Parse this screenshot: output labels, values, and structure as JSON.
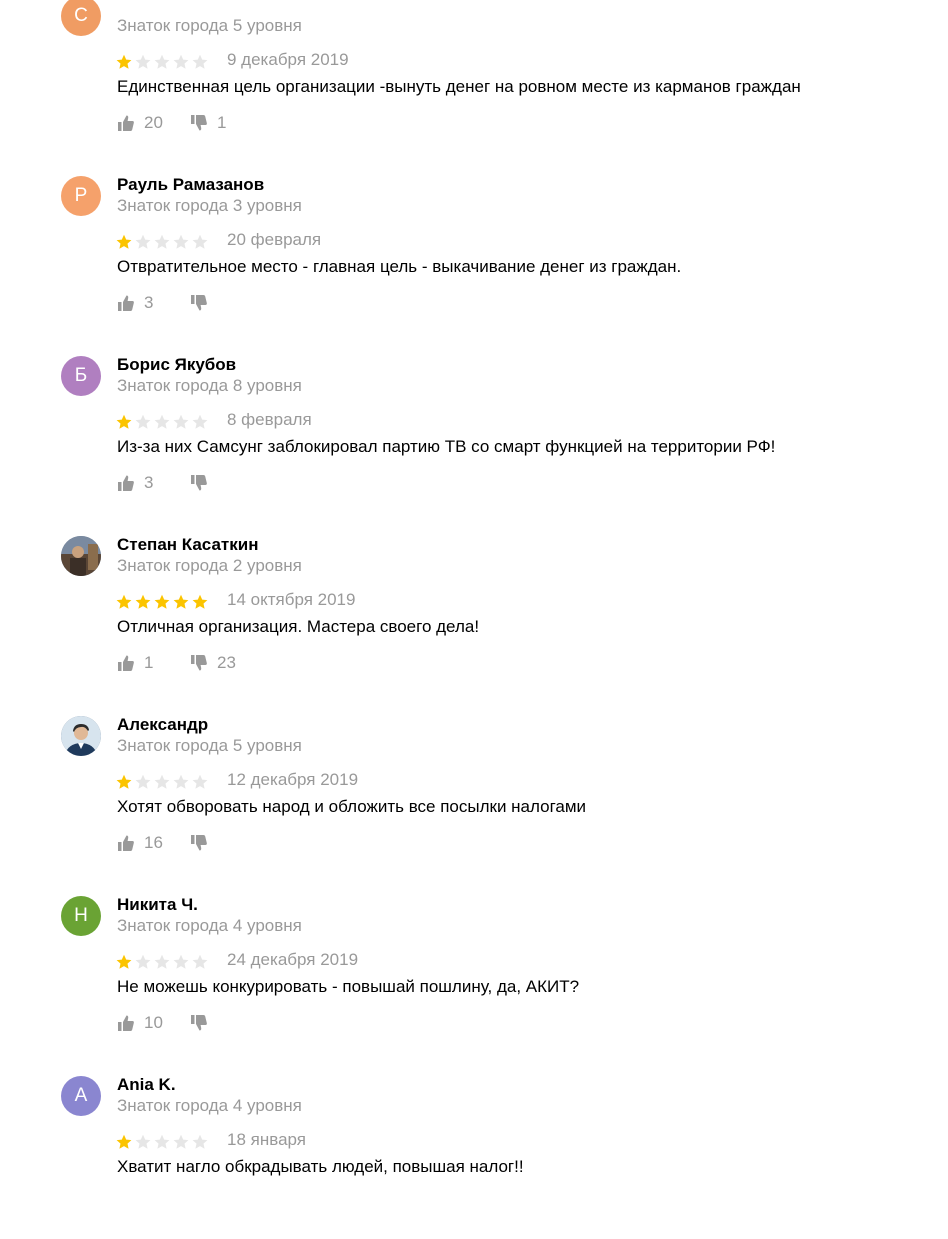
{
  "colors": {
    "star_filled": "#fbc400",
    "star_empty": "#e6e6e6",
    "muted_text": "#999999",
    "icon": "#999999"
  },
  "reviews": [
    {
      "author": "",
      "avatar_letter": "С",
      "avatar_color": "#f09c63",
      "level": "Знаток города 5 уровня",
      "rating": 1,
      "date": "9 декабря 2019",
      "text": "Единственная цель организации -вынуть денег на ровном месте из карманов граждан",
      "likes": "20",
      "dislikes": "1"
    },
    {
      "author": "Рауль Рамазанов",
      "avatar_letter": "Р",
      "avatar_color": "#f5a16b",
      "level": "Знаток города 3 уровня",
      "rating": 1,
      "date": "20 февраля",
      "text": "Отвратительное место - главная цель - выкачивание денег из граждан.",
      "likes": "3",
      "dislikes": ""
    },
    {
      "author": "Борис Якубов",
      "avatar_letter": "Б",
      "avatar_color": "#b07fc0",
      "level": "Знаток города 8 уровня",
      "rating": 1,
      "date": "8 февраля",
      "text": "Из-за них Самсунг заблокировал партию ТВ со смарт функцией на территории РФ!",
      "likes": "3",
      "dislikes": ""
    },
    {
      "author": "Степан Касаткин",
      "avatar_letter": "",
      "avatar_color": "#6a5a4a",
      "level": "Знаток города 2 уровня",
      "rating": 5,
      "date": "14 октября 2019",
      "text": "Отличная организация. Мастера своего дела!",
      "likes": "1",
      "dislikes": "23"
    },
    {
      "author": "Александр",
      "avatar_letter": "",
      "avatar_color": "#9fb8cc",
      "level": "Знаток города 5 уровня",
      "rating": 1,
      "date": "12 декабря 2019",
      "text": "Хотят обворовать народ и обложить все посылки налогами",
      "likes": "16",
      "dislikes": ""
    },
    {
      "author": "Никита Ч.",
      "avatar_letter": "Н",
      "avatar_color": "#6aa334",
      "level": "Знаток города 4 уровня",
      "rating": 1,
      "date": "24 декабря 2019",
      "text": "Не можешь конкурировать - повышай пошлину, да, АКИТ?",
      "likes": "10",
      "dislikes": ""
    },
    {
      "author": "Ania K.",
      "avatar_letter": "A",
      "avatar_color": "#8a86d0",
      "level": "Знаток города 4 уровня",
      "rating": 1,
      "date": "18 января",
      "text": "Хватит нагло обкрадывать людей, повышая налог!!",
      "likes": "",
      "dislikes": ""
    }
  ]
}
